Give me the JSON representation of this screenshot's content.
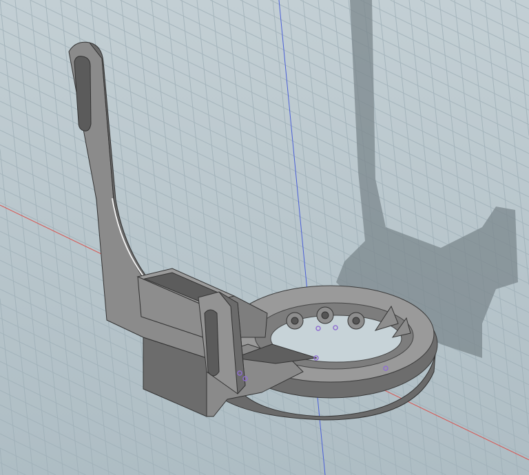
{
  "viewport": {
    "background_top": "#c3cfd4",
    "background_bottom": "#aebdc4",
    "grid_color": "#9fb0b8",
    "axis_x_color": "#d9534f",
    "axis_z_color": "#4a5fd6",
    "shadow_color": "#6f7a7f",
    "model_color": "#8a8a8a",
    "model_dark": "#5f5f5f",
    "model_light": "#a6a6a6",
    "selection_point_color": "#8f6fd0"
  }
}
